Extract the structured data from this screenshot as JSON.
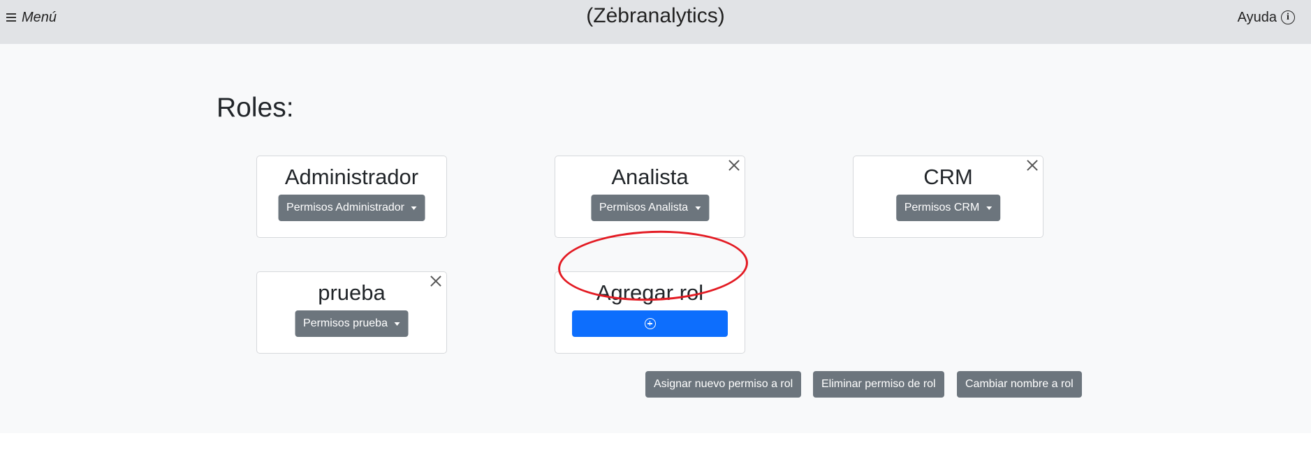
{
  "header": {
    "menu_label": "Menú",
    "title": "(Zėbranalytics)",
    "help_label": "Ayuda"
  },
  "roles_heading": "Roles:",
  "roles": [
    {
      "name": "Administrador",
      "perm_label": "Permisos Administrador",
      "deletable": false
    },
    {
      "name": "Analista",
      "perm_label": "Permisos Analista",
      "deletable": true
    },
    {
      "name": "CRM",
      "perm_label": "Permisos CRM",
      "deletable": true
    },
    {
      "name": "prueba",
      "perm_label": "Permisos prueba",
      "deletable": true
    }
  ],
  "add_role": {
    "title": "Agregar rol",
    "icon": "plus-circle-icon"
  },
  "actions": {
    "assign": "Asignar nuevo permiso a rol",
    "remove": "Eliminar permiso de rol",
    "rename": "Cambiar nombre a rol"
  },
  "colors": {
    "topbar": "#e1e3e6",
    "background": "#f8f9fa",
    "secondary_button": "#6c757d",
    "primary_button": "#0d6efd",
    "annotation": "#e31b23"
  }
}
